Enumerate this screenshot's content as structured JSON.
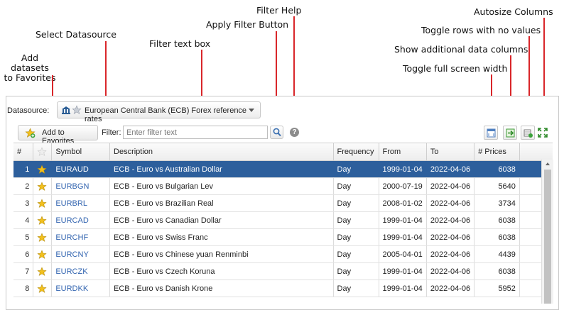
{
  "annotations": {
    "add_favorites": "Add datasets\nto Favorites",
    "select_datasource": "Select Datasource",
    "filter_text_box": "Filter text box",
    "apply_filter": "Apply Filter Button",
    "filter_help": "Filter Help",
    "autosize": "Autosize Columns",
    "toggle_rows": "Toggle  rows with no values",
    "show_columns": "Show additional data columns",
    "toggle_fullscreen": "Toggle full screen width"
  },
  "datasource": {
    "label": "Datasource:",
    "selected": "European Central Bank (ECB) Forex reference rates"
  },
  "toolbar": {
    "add_favorites_label": "Add to Favorites",
    "filter_label": "Filter:",
    "filter_value": "",
    "filter_placeholder": "Enter filter text",
    "help_symbol": "?"
  },
  "colors": {
    "accent_line": "#d9262a",
    "selected_row": "#2d5f9c",
    "symbol_link": "#3365b0",
    "star_gold": "#f2c01e"
  },
  "table": {
    "headers": [
      "#",
      "",
      "Symbol",
      "Description",
      "Frequency",
      "From",
      "To",
      "# Prices"
    ],
    "rows": [
      {
        "idx": "1",
        "symbol": "EURAUD",
        "description": "ECB - Euro vs Australian Dollar",
        "frequency": "Day",
        "from": "1999-01-04",
        "to": "2022-04-06",
        "prices": "6038"
      },
      {
        "idx": "2",
        "symbol": "EURBGN",
        "description": "ECB - Euro vs Bulgarian Lev",
        "frequency": "Day",
        "from": "2000-07-19",
        "to": "2022-04-06",
        "prices": "5640"
      },
      {
        "idx": "3",
        "symbol": "EURBRL",
        "description": "ECB - Euro vs Brazilian Real",
        "frequency": "Day",
        "from": "2008-01-02",
        "to": "2022-04-06",
        "prices": "3734"
      },
      {
        "idx": "4",
        "symbol": "EURCAD",
        "description": "ECB - Euro vs Canadian Dollar",
        "frequency": "Day",
        "from": "1999-01-04",
        "to": "2022-04-06",
        "prices": "6038"
      },
      {
        "idx": "5",
        "symbol": "EURCHF",
        "description": "ECB - Euro vs Swiss Franc",
        "frequency": "Day",
        "from": "1999-01-04",
        "to": "2022-04-06",
        "prices": "6038"
      },
      {
        "idx": "6",
        "symbol": "EURCNY",
        "description": "ECB - Euro vs Chinese yuan Renminbi",
        "frequency": "Day",
        "from": "2005-04-01",
        "to": "2022-04-06",
        "prices": "4439"
      },
      {
        "idx": "7",
        "symbol": "EURCZK",
        "description": "ECB - Euro vs Czech Koruna",
        "frequency": "Day",
        "from": "1999-01-04",
        "to": "2022-04-06",
        "prices": "6038"
      },
      {
        "idx": "8",
        "symbol": "EURDKK",
        "description": "ECB - Euro vs Danish Krone",
        "frequency": "Day",
        "from": "1999-01-04",
        "to": "2022-04-06",
        "prices": "5952"
      }
    ]
  }
}
